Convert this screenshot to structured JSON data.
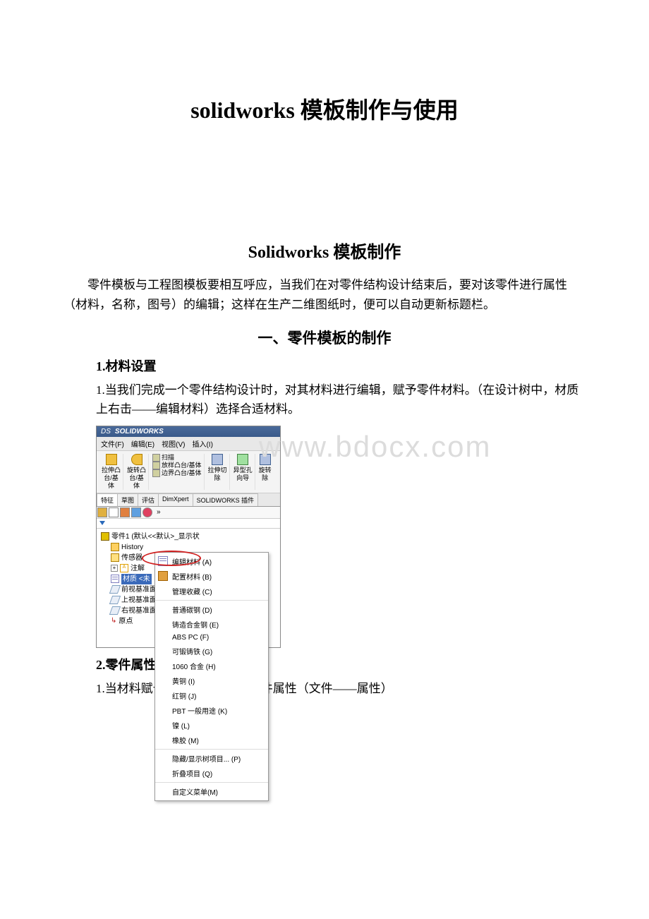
{
  "doc": {
    "title": "solidworks 模板制作与使用",
    "subtitle": "Solidworks 模板制作",
    "intro": "零件模板与工程图模板要相互呼应，当我们在对零件结构设计结束后，要对该零件进行属性（材料，名称，图号）的编辑；这样在生产二维图纸时，便可以自动更新标题栏。",
    "section1_title": "一、零件模板的制作",
    "h1": "1.材料设置",
    "p1": "1.当我们完成一个零件结构设计时，对其材料进行编辑，赋予零件材料。（在设计树中，材质上右击——编辑材料）选择合适材料。",
    "h2": "2.零件属性设置",
    "p2": "1.当材料赋予结束后，需设置零件属性（文件——属性）"
  },
  "watermark": "www.bdocx.com",
  "sw": {
    "app_name": "SOLIDWORKS",
    "menus": {
      "file": "文件(F)",
      "edit": "编辑(E)",
      "view": "视图(V)",
      "insert": "插入(I)"
    },
    "ribbon": {
      "extrude": "拉伸凸\n台/基\n体",
      "revolve": "旋转凸\n台/基\n体",
      "sweep": "扫描",
      "loft": "放样凸台/基体",
      "boundary": "边界凸台/基体",
      "cut": "拉伸切\n除",
      "hole": "异型孔\n向导",
      "revcut": "旋转\n除"
    },
    "tabs": {
      "feature": "特征",
      "sketch": "草图",
      "evaluate": "评估",
      "dimxpert": "DimXpert",
      "plugin": "SOLIDWORKS 插件"
    },
    "toolbar_chev": "»",
    "tree": {
      "part": "零件1 (默认<<默认>_显示状",
      "history": "History",
      "sensor": "传感器",
      "annotation": "注解",
      "material": "材质 <未",
      "front": "前视基准面",
      "top": "上视基准面",
      "right": "右视基准面",
      "origin": "原点"
    },
    "context": {
      "edit_material": "编辑材料 (A)",
      "config_material": "配置材料 (B)",
      "manage_fav": "管理收藏 (C)",
      "carbon": "普通碳钢 (D)",
      "cast_alloy": "铸造合金钢 (E)",
      "abs": "ABS PC (F)",
      "ductile": "可锻铸铁 (G)",
      "alloy1060": "1060 合金 (H)",
      "brass": "黄铜 (I)",
      "copper": "红铜 (J)",
      "pbt": "PBT 一般用途 (K)",
      "nickel": "镍 (L)",
      "rubber": "橡胶 (M)",
      "hide_show": "隐藏/显示树项目... (P)",
      "collapse": "折叠项目 (Q)",
      "custom": "自定义菜单(M)"
    }
  }
}
